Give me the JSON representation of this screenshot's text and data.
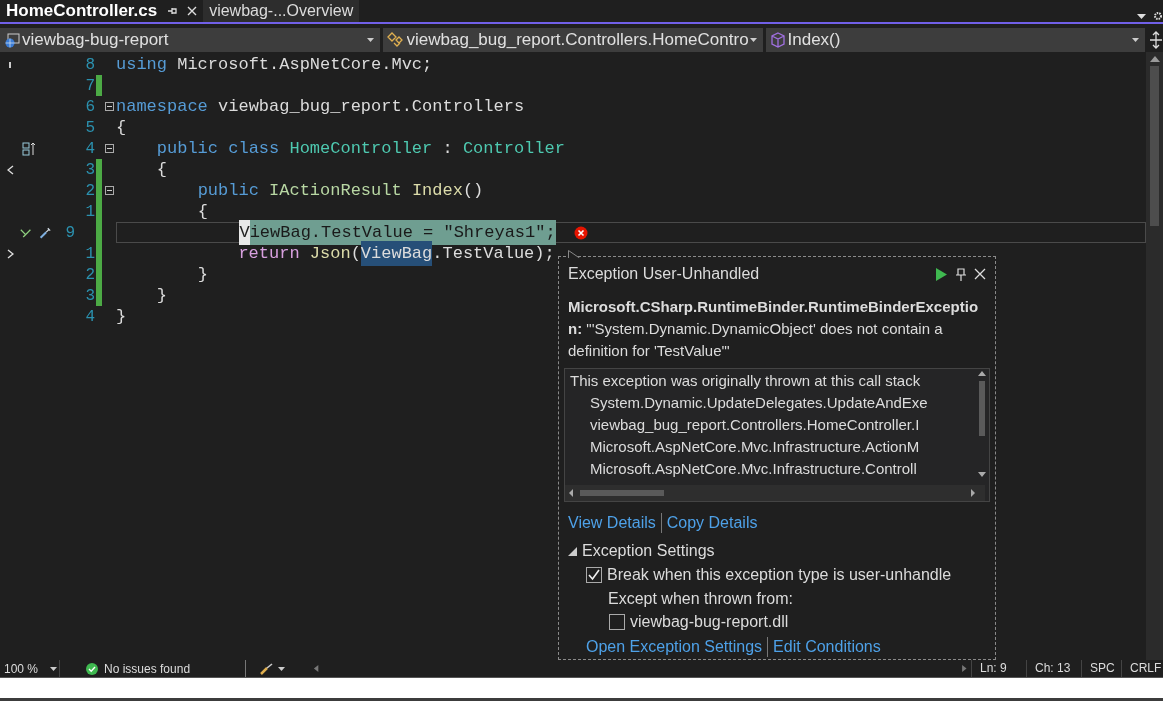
{
  "tabs": [
    {
      "label": "HomeController.cs",
      "selected": true
    },
    {
      "label": "viewbag-...Overview",
      "selected": false
    }
  ],
  "navigation": [
    {
      "kind": "project",
      "label": "viewbag-bug-report"
    },
    {
      "kind": "class",
      "label": "viewbag_bug_report.Controllers.HomeContro"
    },
    {
      "kind": "member",
      "label": "Index()"
    }
  ],
  "code_lines": [
    {
      "number": "8",
      "changed": false,
      "fold": false,
      "tokens": [
        {
          "kind": "keyword",
          "text": "using"
        },
        {
          "kind": "plain",
          "text": " Microsoft.AspNetCore.Mvc;"
        }
      ]
    },
    {
      "number": "7",
      "changed": true,
      "fold": false
    },
    {
      "number": "6",
      "changed": false,
      "fold": true,
      "tokens": [
        {
          "kind": "keyword",
          "text": "namespace"
        },
        {
          "kind": "plain",
          "text": " viewbag_bug_report.Controllers"
        }
      ]
    },
    {
      "number": "5",
      "changed": false,
      "fold": false,
      "tokens": [
        {
          "kind": "plain",
          "text": "{"
        }
      ]
    },
    {
      "number": "4",
      "changed": false,
      "fold": true,
      "tokens": [
        {
          "kind": "keyword",
          "text": "    public class"
        },
        {
          "kind": "type",
          "text": " HomeController"
        },
        {
          "kind": "plain",
          "text": " : "
        },
        {
          "kind": "type",
          "text": "Controller"
        }
      ]
    },
    {
      "number": "3",
      "changed": true,
      "fold": false,
      "tokens": [
        {
          "kind": "plain",
          "text": "    {"
        }
      ]
    },
    {
      "number": "2",
      "changed": true,
      "fold": true,
      "tokens": [
        {
          "kind": "keyword",
          "text": "        public"
        },
        {
          "kind": "interface",
          "text": " IActionResult"
        },
        {
          "kind": "method",
          "text": " Index"
        },
        {
          "kind": "plain",
          "text": "()"
        }
      ]
    },
    {
      "number": "1",
      "changed": true,
      "fold": false,
      "tokens": [
        {
          "kind": "plain",
          "text": "        {"
        }
      ]
    },
    {
      "number": "9",
      "current": true,
      "changed": true,
      "fold": false,
      "error": true,
      "tokens": [
        {
          "kind": "cursor",
          "text": "            V"
        },
        {
          "kind": "statement-highlight",
          "text": "iewBag.TestValue = \"Shreyas1\";"
        }
      ]
    },
    {
      "number": "1",
      "changed": true,
      "fold": false,
      "tokens": [
        {
          "kind": "control",
          "text": "            return"
        },
        {
          "kind": "method",
          "text": " Json"
        },
        {
          "kind": "plain",
          "text": "("
        },
        {
          "kind": "reference-highlight",
          "text": "ViewBag"
        },
        {
          "kind": "plain",
          "text": ".TestValue);"
        }
      ]
    },
    {
      "number": "2",
      "changed": true,
      "fold": false,
      "tokens": [
        {
          "kind": "plain",
          "text": "        }"
        }
      ]
    },
    {
      "number": "3",
      "changed": true,
      "fold": false,
      "tokens": [
        {
          "kind": "plain",
          "text": "    }"
        }
      ]
    },
    {
      "number": "4",
      "changed": false,
      "fold": false,
      "tokens": [
        {
          "kind": "plain",
          "text": "}"
        }
      ]
    }
  ],
  "exception_popup": {
    "title": "Exception User-Unhandled",
    "message": "**Microsoft.CSharp.RuntimeBinder.RuntimeBinderException:** \"'System.Dynamic.DynamicObject' does not contain a definition for 'TestValue'\"",
    "stack_heading": "This exception was originally thrown at this call stack",
    "stack": [
      "System.Dynamic.UpdateDelegates.UpdateAndExe",
      "viewbag_bug_report.Controllers.HomeController.I",
      "Microsoft.AspNetCore.Mvc.Infrastructure.ActionM",
      "Microsoft.AspNetCore.Mvc.Infrastructure.Controll"
    ],
    "links": [
      "View Details",
      "Copy Details"
    ],
    "settings": {
      "label": "Exception Settings",
      "expanded": true,
      "break_option": {
        "label": "Break when this exception type is user-unhandle",
        "checked": true
      },
      "except_label": "Except when thrown from:",
      "module_option": {
        "label": "viewbag-bug-report.dll",
        "checked": false
      }
    },
    "bottom_links": [
      "Open Exception Settings",
      "Edit Conditions"
    ]
  },
  "status_bar": {
    "zoom": "100 %",
    "issues": "No issues found",
    "line": "Ln: 9",
    "column": "Ch: 13",
    "whitespace": "SPC",
    "line_ending": "CRLF"
  }
}
